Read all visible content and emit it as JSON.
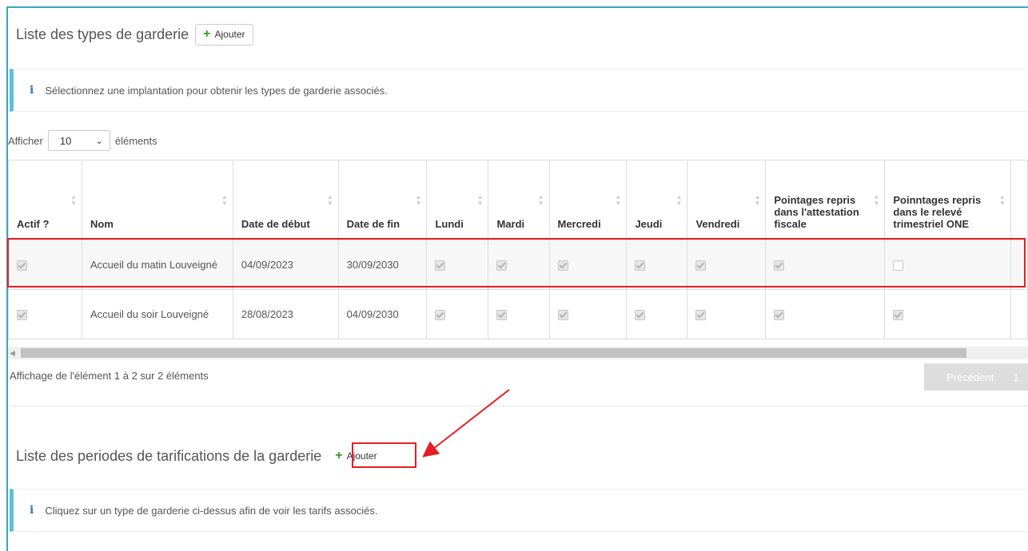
{
  "section1": {
    "title": "Liste des types de garderie",
    "add_label": "Ajouter",
    "info": "Sélectionnez une implantation pour obtenir les types de garderie associés."
  },
  "length_control": {
    "prefix": "Afficher",
    "value": "10",
    "suffix": "éléments"
  },
  "table": {
    "headers": [
      "Actif ?",
      "Nom",
      "Date de début",
      "Date de fin",
      "Lundi",
      "Mardi",
      "Mercredi",
      "Jeudi",
      "Vendredi",
      "Pointages repris dans l'attestation fiscale",
      "Poinntages repris dans le relevé trimestriel ONE"
    ],
    "rows": [
      {
        "actif": true,
        "nom": "Accueil du matin Louveigné",
        "debut": "04/09/2023",
        "fin": "30/09/2030",
        "lundi": true,
        "mardi": true,
        "mercredi": true,
        "jeudi": true,
        "vendredi": true,
        "fiscale": true,
        "one": false
      },
      {
        "actif": true,
        "nom": "Accueil du soir Louveigné",
        "debut": "28/08/2023",
        "fin": "04/09/2030",
        "lundi": true,
        "mardi": true,
        "mercredi": true,
        "jeudi": true,
        "vendredi": true,
        "fiscale": true,
        "one": true
      }
    ]
  },
  "pagination": {
    "info": "Affichage de l'élément 1 à 2 sur 2 éléments",
    "prev_label": "Précédent",
    "page": "1"
  },
  "section2": {
    "title": "Liste des periodes de tarifications de la garderie",
    "add_label": "Ajouter",
    "info": "Cliquez sur un type de garderie ci-dessus afin de voir les tarifs associés."
  },
  "colors": {
    "accent": "#5bc0de",
    "frame": "#3aa7b5",
    "highlight": "#e31e24",
    "plus": "#3c9a2c"
  }
}
